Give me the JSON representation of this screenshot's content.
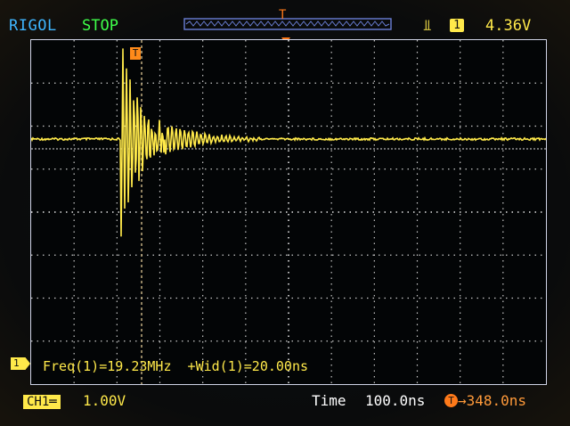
{
  "header": {
    "brand": "RIGOL",
    "run_state": "STOP",
    "trigger_icon": "⫫",
    "trigger_source": "1",
    "trigger_level": "4.36V"
  },
  "screen": {
    "trigger_marker": "T",
    "cursor_marker": "T",
    "channel_marker": "1",
    "measurement": "Freq(1)=19.23MHz  +Wid(1)=20.00ns"
  },
  "footer": {
    "channel_label": "CH1",
    "channel_coupling_icon": "═",
    "channel_scale": "1.00V",
    "time_label": "Time",
    "time_scale": "100.0ns",
    "trigger_offset_icon": "T",
    "trigger_offset": "→348.0ns"
  },
  "colors": {
    "channel": "#ffe94a",
    "trigger": "#ff7a1a",
    "brand": "#3fb6ff",
    "run_state": "#3fff4a"
  }
}
